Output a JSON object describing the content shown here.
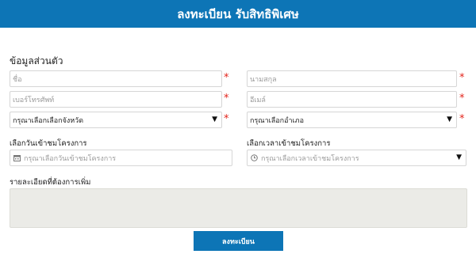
{
  "header": {
    "title": "ลงทะเบียน รับสิทธิพิเศษ"
  },
  "personal": {
    "section_title": "ข้อมูลส่วนตัว",
    "first_name_placeholder": "ชื่อ",
    "last_name_placeholder": "นามสกุล",
    "phone_placeholder": "เบอร์โทรศัพท์",
    "email_placeholder": "อีเมล์",
    "province_selected": "กรุณาเลือกเลือกจังหวัด",
    "district_selected": "กรุณาเลือกอำเภอ",
    "required_mark": "*"
  },
  "visit": {
    "date_label": "เลือกวันเข้าชมโครงการ",
    "date_placeholder": "กรุณาเลือกวันเข้าชมโครงการ",
    "time_label": "เลือกเวลาเข้าชมโครงการ",
    "time_placeholder": "กรุณาเลือกเวลาเข้าชมโครงการ"
  },
  "details": {
    "label": "รายละเอียดที่ต้องการเพิ่ม"
  },
  "submit": {
    "label": "ลงทะเบียน"
  },
  "icons": {
    "dropdown": "caret-down-icon",
    "calendar": "calendar-icon",
    "clock": "clock-icon"
  },
  "colors": {
    "brand": "#0d75b6",
    "required": "#e2231a",
    "notes_bg": "#ebebe7"
  }
}
